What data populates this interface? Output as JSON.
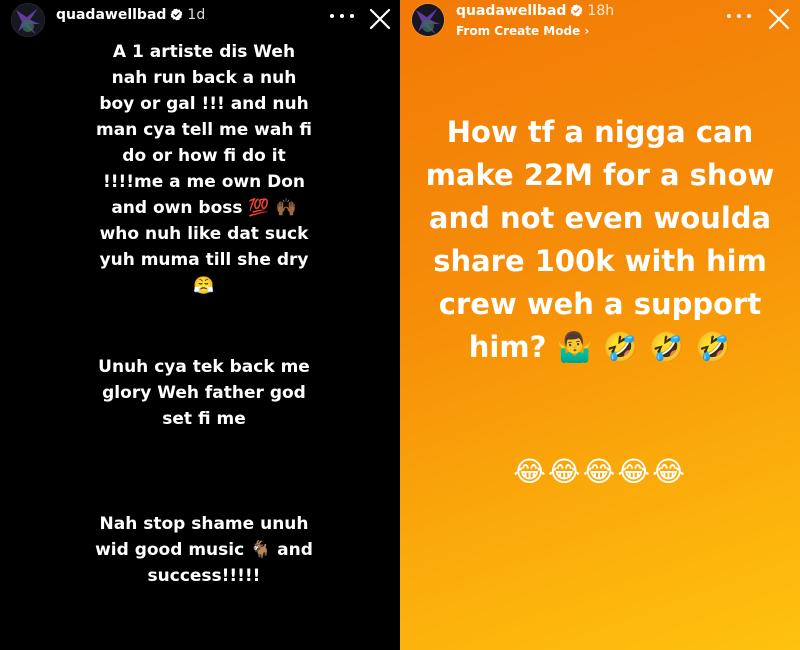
{
  "left_story": {
    "username": "quadawellbad",
    "time": "1d",
    "paragraphs": [
      "A 1 artiste dis Weh nah run back a nuh boy or gal !!! and nuh man cya tell me wah fi do or how fi do it !!!!me a me own Don and own boss 💯 🙌🏾 who nuh like dat suck yuh muma till she dry 😤",
      "Unuh cya tek back me glory Weh father god set fi me",
      "Nah stop shame unuh wid good music 🐐 and success!!!!!"
    ]
  },
  "right_story": {
    "username": "quadawellbad",
    "time": "18h",
    "subtitle": "From Create Mode ›",
    "text": "How tf a nigga can make 22M for a show and not even woulda share 100k with him crew weh a support him? 🤷‍♂️ 🤣 🤣 🤣",
    "emoji_line": "😂😂😂😂😂"
  },
  "icons": {
    "verified": "verified-badge-icon",
    "more": "more-options-icon",
    "close": "close-icon",
    "avatar": "profile-avatar"
  },
  "colors": {
    "left_background": "#000000",
    "right_gradient_start": "#f27a07",
    "right_gradient_end": "#ffc20e",
    "text": "#ffffff"
  }
}
